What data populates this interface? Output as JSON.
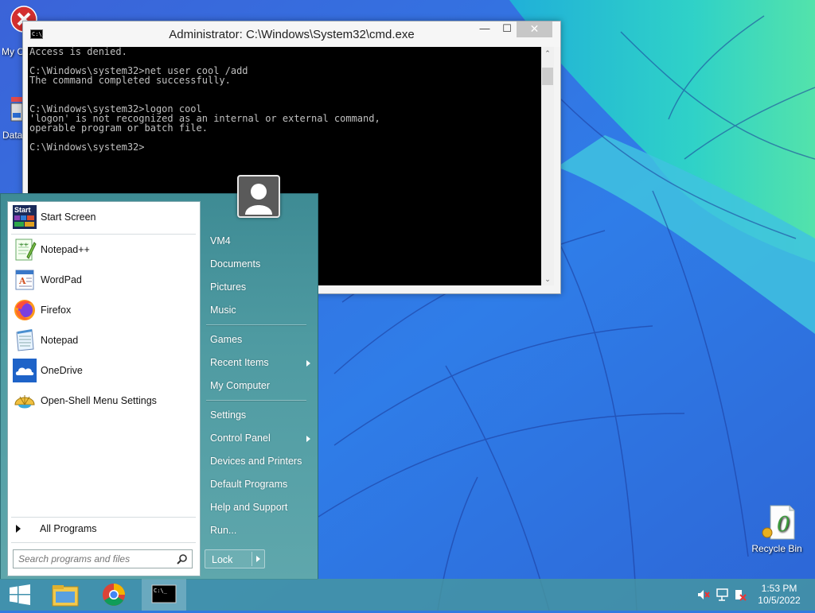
{
  "window": {
    "title": "Administrator: C:\\Windows\\System32\\cmd.exe",
    "icon": "cmd-icon",
    "icon_text": "C:\\_",
    "minimize_icon": "minimize-icon",
    "maximize_icon": "maximize-icon",
    "close_icon": "close-icon",
    "console_lines": [
      "Access is denied.",
      "",
      "C:\\Windows\\system32>net user cool /add",
      "The command completed successfully.",
      "",
      "",
      "C:\\Windows\\system32>logon cool",
      "'logon' is not recognized as an internal or external command,",
      "operable program or batch file.",
      "",
      "C:\\Windows\\system32>"
    ]
  },
  "desktop": {
    "icons": [
      {
        "label": "My C",
        "icon": "error-icon"
      },
      {
        "label": "Data",
        "icon": "database-icon"
      },
      {
        "label": "Recycle Bin",
        "icon": "recycle-bin-icon"
      }
    ]
  },
  "start_menu": {
    "programs": [
      {
        "label": "Start Screen",
        "icon": "start-screen-icon",
        "icon_text": "Start"
      },
      {
        "label": "Notepad++",
        "icon": "notepad-plus-plus-icon"
      },
      {
        "label": "WordPad",
        "icon": "wordpad-icon"
      },
      {
        "label": "Firefox",
        "icon": "firefox-icon"
      },
      {
        "label": "Notepad",
        "icon": "notepad-icon"
      },
      {
        "label": "OneDrive",
        "icon": "onedrive-icon"
      },
      {
        "label": "Open-Shell Menu Settings",
        "icon": "open-shell-icon"
      }
    ],
    "all_programs": "All Programs",
    "search_placeholder": "Search programs and files",
    "right_items": [
      {
        "label": "VM4"
      },
      {
        "label": "Documents"
      },
      {
        "label": "Pictures"
      },
      {
        "label": "Music"
      },
      {
        "label": "Games"
      },
      {
        "label": "Recent Items",
        "submenu": true
      },
      {
        "label": "My Computer"
      },
      {
        "label": "Settings"
      },
      {
        "label": "Control Panel",
        "submenu": true
      },
      {
        "label": "Devices and Printers"
      },
      {
        "label": "Default Programs"
      },
      {
        "label": "Help and Support"
      },
      {
        "label": "Run..."
      }
    ],
    "lock_label": "Lock",
    "user_icon": "user-avatar-icon"
  },
  "taskbar": {
    "start_icon": "windows-logo-icon",
    "pinned": [
      "file-explorer-icon",
      "chrome-icon",
      "cmd-icon"
    ],
    "active": "cmd-icon",
    "tray_icons": [
      "volume-muted-icon",
      "network-icon",
      "action-center-icon"
    ],
    "time": "1:53 PM",
    "date": "10/5/2022"
  },
  "colors": {
    "start_menu": "#4a969e",
    "taskbar": "#4696a0",
    "console_bg": "#000000",
    "console_text": "#c0c0c0"
  }
}
